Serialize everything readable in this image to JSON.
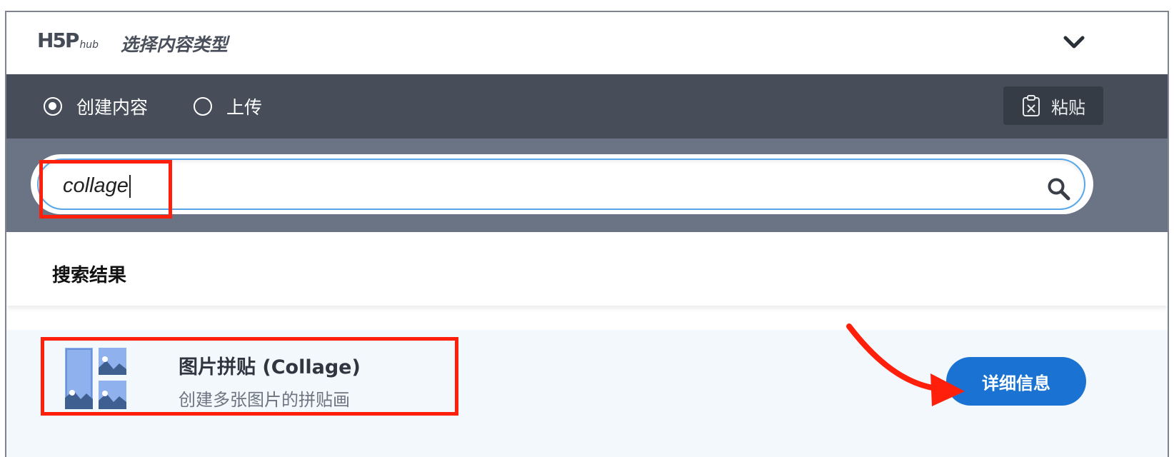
{
  "header": {
    "logo_main": "H5P",
    "logo_sub": "hub",
    "title": "选择内容类型",
    "collapse_icon": "chevron-down-icon"
  },
  "tabs": [
    {
      "label": "创建内容",
      "selected": true
    },
    {
      "label": "上传",
      "selected": false
    }
  ],
  "paste": {
    "label": "粘贴",
    "icon": "clipboard-icon"
  },
  "search": {
    "value": "collage",
    "icon": "search-icon"
  },
  "results": {
    "heading": "搜索结果",
    "items": [
      {
        "title": "图片拼贴 (Collage)",
        "description": "创建多张图片的拼贴画",
        "details_label": "详细信息",
        "icon": "collage-icon"
      }
    ]
  },
  "annotations": {
    "highlight_color": "#ff1f0a",
    "accent_color": "#1a73d2"
  }
}
